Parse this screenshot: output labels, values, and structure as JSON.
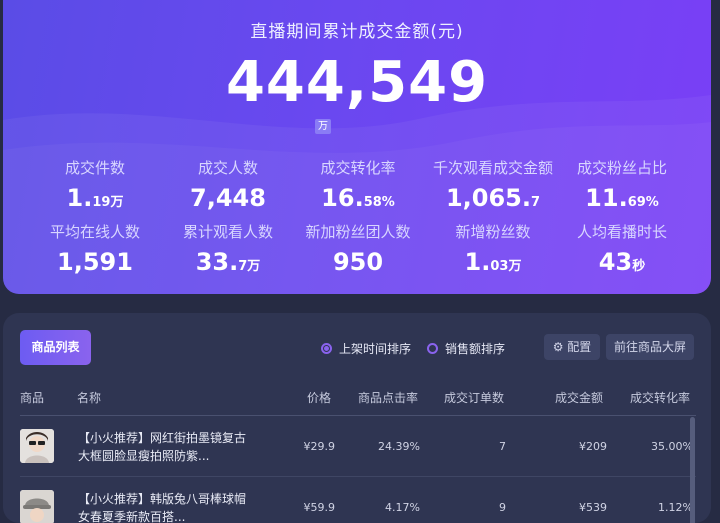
{
  "hero": {
    "title": "直播期间累计成交金额(元)",
    "value": "444,549",
    "unit": "万"
  },
  "stats": [
    {
      "label": "成交件数",
      "main": "1.",
      "small": "19万"
    },
    {
      "label": "成交人数",
      "main": "7,448",
      "small": ""
    },
    {
      "label": "成交转化率",
      "main": "16.",
      "small": "58%"
    },
    {
      "label": "千次观看成交金额",
      "main": "1,065.",
      "small": "7"
    },
    {
      "label": "成交粉丝占比",
      "main": "11.",
      "small": "69%"
    },
    {
      "label": "平均在线人数",
      "main": "1,591",
      "small": ""
    },
    {
      "label": "累计观看人数",
      "main": "33.",
      "small": "7万"
    },
    {
      "label": "新加粉丝团人数",
      "main": "950",
      "small": ""
    },
    {
      "label": "新增粉丝数",
      "main": "1.",
      "small": "03万"
    },
    {
      "label": "人均看播时长",
      "main": "43",
      "small": "秒"
    }
  ],
  "panel": {
    "tab_label": "商品列表",
    "sort_options": [
      {
        "label": "上架时间排序",
        "selected": true
      },
      {
        "label": "销售额排序",
        "selected": false
      }
    ],
    "config_label": "配置",
    "bigscreen_label": "前往商品大屏",
    "columns": [
      "商品",
      "名称",
      "价格",
      "商品点击率",
      "成交订单数",
      "成交金额",
      "成交转化率"
    ],
    "rows": [
      {
        "name": "【小火推荐】网红街拍墨镜复古大框圆脸显瘦拍照防紫...",
        "price": "¥29.9",
        "ctr": "24.39%",
        "orders": "7",
        "amount": "¥209",
        "cvr": "35.00%"
      },
      {
        "name": "【小火推荐】韩版兔八哥棒球帽女春夏季新款百搭...",
        "price": "¥59.9",
        "ctr": "4.17%",
        "orders": "9",
        "amount": "¥539",
        "cvr": "1.12%"
      }
    ]
  },
  "colors": {
    "accent": "#8a63ee",
    "panel": "#2f3552",
    "page": "#262b43"
  }
}
